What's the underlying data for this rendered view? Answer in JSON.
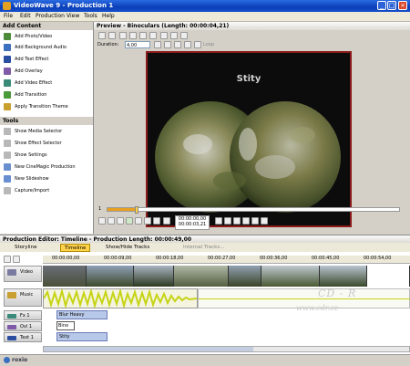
{
  "window": {
    "title": "VideoWave 9 - Production 1",
    "min": "_",
    "max": "□",
    "close": "×"
  },
  "menu": [
    "File",
    "Edit",
    "Production",
    "View",
    "Tools",
    "Help"
  ],
  "add_content": {
    "header": "Add Content",
    "items": [
      "Add Photo/Video",
      "Add Background Audio",
      "Add Text Effect",
      "Add Overlay",
      "Add Video Effect",
      "Add Transition",
      "Apply Transition Theme"
    ]
  },
  "tools": {
    "header": "Tools",
    "items": [
      "Show Media Selector",
      "Show Effect Selector",
      "Show Settings",
      "New CineMagic Production",
      "New Slideshow",
      "Capture/Import"
    ]
  },
  "preview": {
    "header": "Preview - Binoculars (Length: 00:00:04,21)",
    "duration_label": "Duration:",
    "duration_value": "4,00",
    "loop_label": "Loop",
    "video_text": "Stity",
    "frame_index": "1",
    "time_main": "00:00:00,00",
    "time_end": "00:00:03,21",
    "scrub_fraction": 0.1
  },
  "production_editor": {
    "header": "Production Editor: Timeline - Production Length: 00:00:49,00",
    "tabs": [
      "Storyline",
      "Timeline",
      "Show/Hide Tracks",
      "Internal Tracks..."
    ],
    "ruler": [
      "00:00:00,00",
      "00:00:09,00",
      "00:00:18,00",
      "00:00:27,00",
      "00:00:36,00",
      "00:00:45,00",
      "00:00:54,00"
    ],
    "tracks": {
      "video": "Video",
      "music": "Music",
      "fx": "Fx 1",
      "overlay": "Ovl 1",
      "text": "Text 1"
    },
    "clips": {
      "fx": "Blur Heavy",
      "overlay": "Bino",
      "text": "Stity"
    }
  },
  "watermark": {
    "line1": "CD - R",
    "line2": "www.cdr.cz"
  },
  "status": {
    "brand": "roxio"
  }
}
